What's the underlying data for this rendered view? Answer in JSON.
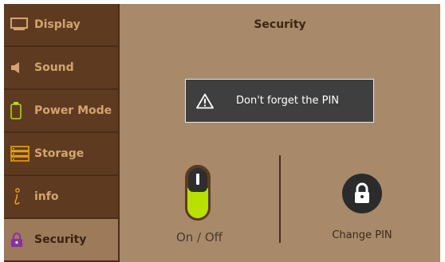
{
  "sidebar": {
    "items": [
      {
        "label": "Display",
        "icon": "monitor-icon"
      },
      {
        "label": "Sound",
        "icon": "speaker-icon"
      },
      {
        "label": "Power Mode",
        "icon": "battery-icon"
      },
      {
        "label": "Storage",
        "icon": "storage-icon"
      },
      {
        "label": "info",
        "icon": "info-icon"
      },
      {
        "label": "Security",
        "icon": "lock-icon",
        "active": true
      }
    ]
  },
  "main": {
    "title": "Security",
    "toast": {
      "message": "Don't forget the PIN",
      "icon": "warning-icon"
    },
    "toggle": {
      "label": "On / Off",
      "state": "on"
    },
    "change_pin": {
      "label": "Change PIN",
      "icon": "lock-icon"
    }
  },
  "colors": {
    "sidebar_bg": "#5e3a20",
    "sidebar_active": "#9c7a5a",
    "main_bg": "#a88a6a",
    "accent_text": "#d3a46f",
    "toggle_on": "#b8e000"
  }
}
